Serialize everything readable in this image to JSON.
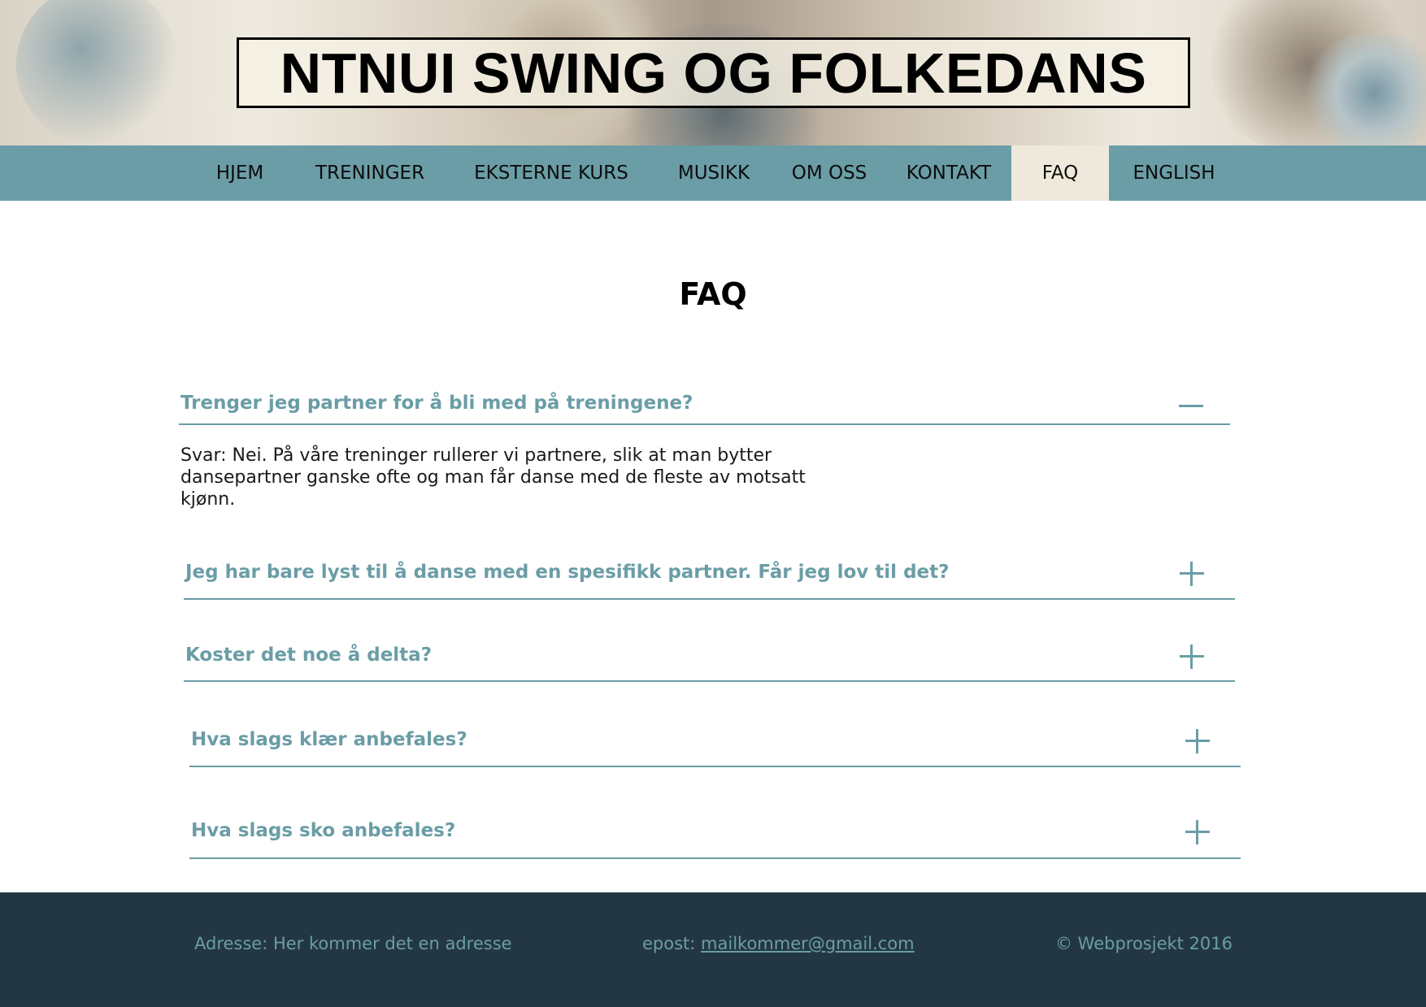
{
  "site": {
    "title": "NTNUI SWING OG FOLKEDANS"
  },
  "nav": {
    "items": [
      {
        "label": "HJEM"
      },
      {
        "label": "TRENINGER"
      },
      {
        "label": "EKSTERNE KURS"
      },
      {
        "label": "MUSIKK"
      },
      {
        "label": "OM OSS"
      },
      {
        "label": "KONTAKT"
      },
      {
        "label": "FAQ",
        "active": true
      },
      {
        "label": "ENGLISH"
      }
    ]
  },
  "main": {
    "page_title": "FAQ",
    "faq": [
      {
        "question": "Trenger jeg partner for å bli med på treningene?",
        "expanded": true,
        "toggle_icon": "minus-icon",
        "answer": "Svar: Nei. På våre treninger rullerer vi partnere, slik at man bytter dansepartner ganske ofte og man får danse med de fleste av motsatt kjønn."
      },
      {
        "question": "Jeg har bare lyst til å danse med en spesifikk partner. Får jeg lov til det?",
        "expanded": false,
        "toggle_icon": "plus-icon"
      },
      {
        "question": "Koster det noe å delta?",
        "expanded": false,
        "toggle_icon": "plus-icon"
      },
      {
        "question": "Hva slags klær anbefales?",
        "expanded": false,
        "toggle_icon": "plus-icon"
      },
      {
        "question": "Hva slags sko anbefales?",
        "expanded": false,
        "toggle_icon": "plus-icon"
      }
    ]
  },
  "footer": {
    "address": "Adresse: Her kommer det en adresse",
    "email_label": "epost: ",
    "email": "mailkommer@gmail.com",
    "copyright": "© Webprosjekt 2016"
  },
  "colors": {
    "accent": "#6a9da6",
    "nav_active_bg": "#efe9dc",
    "footer_bg": "#233743"
  }
}
